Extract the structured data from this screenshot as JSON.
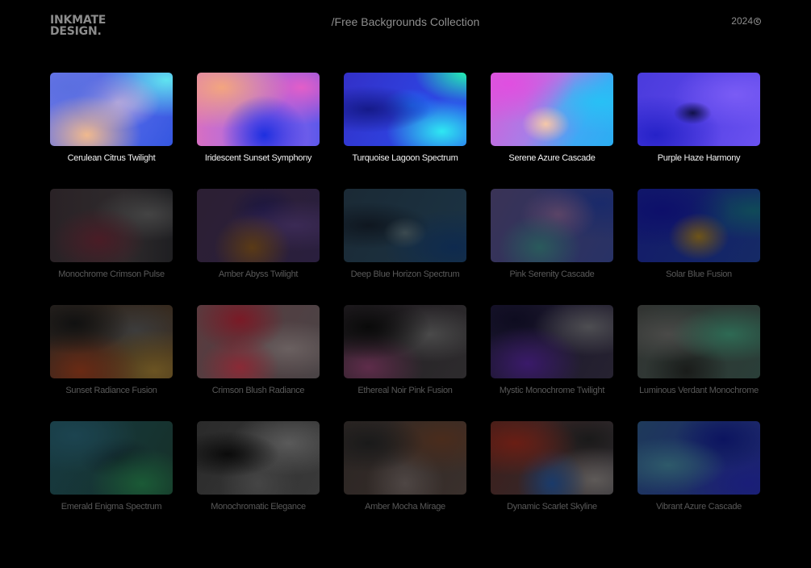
{
  "header": {
    "logo_line1": "INKMATE",
    "logo_line2": "DESIGN.",
    "title": "/Free Backgrounds Collection",
    "year": "2024"
  },
  "icons": {
    "copyright": "copyright-icon"
  },
  "colors": {
    "background": "#000000",
    "featured_label": "#f2f2f2",
    "muted_label": "#595959",
    "header_text": "#8e8e8e"
  },
  "rows": [
    {
      "items": [
        {
          "label": "Cerulean Citrus Twilight"
        },
        {
          "label": "Iridescent Sunset Symphony"
        },
        {
          "label": "Turquoise Lagoon Spectrum"
        },
        {
          "label": "Serene Azure Cascade"
        },
        {
          "label": "Purple Haze Harmony"
        }
      ]
    },
    {
      "items": [
        {
          "label": "Monochrome Crimson Pulse"
        },
        {
          "label": "Amber Abyss Twilight"
        },
        {
          "label": "Deep Blue Horizon Spectrum"
        },
        {
          "label": "Pink Serenity Cascade"
        },
        {
          "label": "Solar Blue Fusion"
        }
      ]
    },
    {
      "items": [
        {
          "label": "Sunset Radiance Fusion"
        },
        {
          "label": "Crimson Blush Radiance"
        },
        {
          "label": "Ethereal Noir Pink Fusion"
        },
        {
          "label": "Mystic Monochrome Twilight"
        },
        {
          "label": "Luminous Verdant Monochrome"
        }
      ]
    },
    {
      "items": [
        {
          "label": "Emerald Enigma Spectrum"
        },
        {
          "label": "Monochromatic Elegance"
        },
        {
          "label": "Amber Mocha Mirage"
        },
        {
          "label": "Dynamic Scarlet Skyline"
        },
        {
          "label": "Vibrant Azure Cascade"
        }
      ]
    }
  ]
}
